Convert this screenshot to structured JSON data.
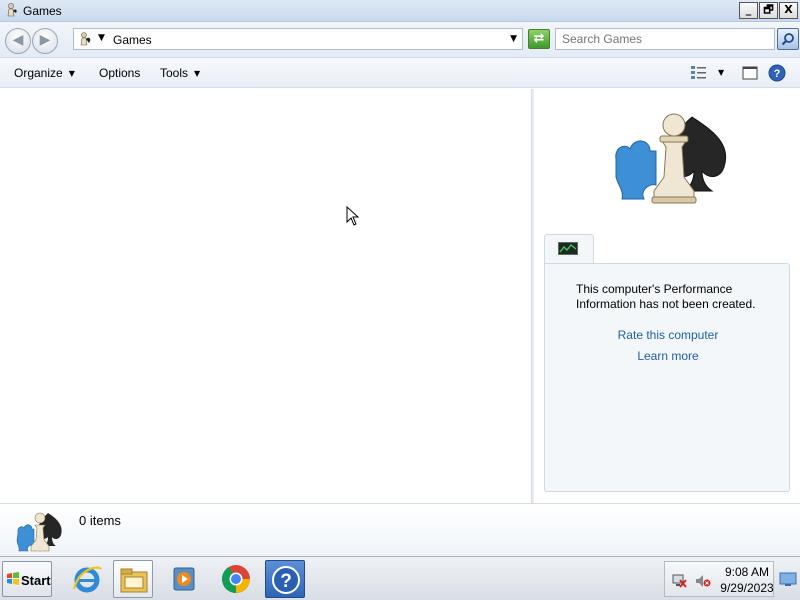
{
  "window": {
    "title": "Games",
    "buttons": {
      "minimize": "_",
      "maximize": "🗗",
      "close": "X"
    }
  },
  "nav": {
    "back_icon": "back-arrow-icon",
    "forward_icon": "forward-arrow-icon",
    "address_crumb": "Games",
    "search_placeholder": "Search Games"
  },
  "commands": {
    "organize": "Organize",
    "options": "Options",
    "tools": "Tools"
  },
  "performance": {
    "message": "This computer's Performance Information has not been created.",
    "rate_link": "Rate this computer",
    "learn_link": "Learn more"
  },
  "details": {
    "item_count": "0 items"
  },
  "taskbar": {
    "start_label": "Start",
    "apps": [
      "internet-explorer",
      "windows-explorer",
      "media-player",
      "chrome",
      "help-and-support"
    ],
    "time": "9:08 AM",
    "date": "9/29/2023"
  },
  "colors": {
    "link": "#1f5fa6",
    "panel_bg": "#f4f7fa",
    "titlebar": "#c9d9ee"
  }
}
